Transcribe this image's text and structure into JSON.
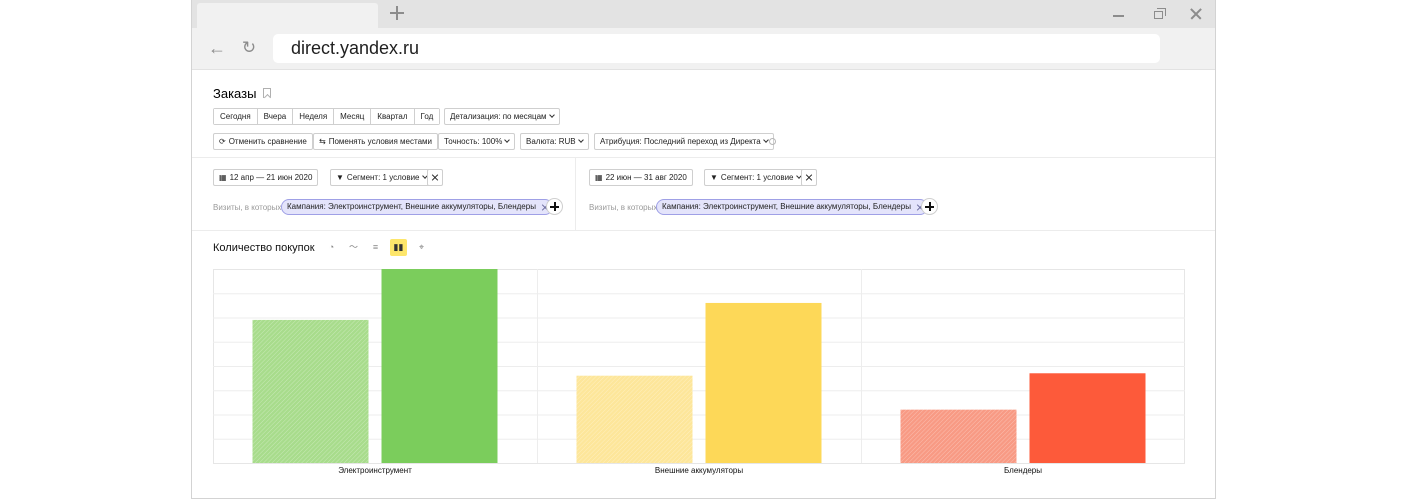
{
  "browser": {
    "url": "direct.yandex.ru"
  },
  "page": {
    "title": "Заказы",
    "periods": [
      "Сегодня",
      "Вчера",
      "Неделя",
      "Месяц",
      "Квартал",
      "Год"
    ],
    "detail_label": "Детализация: по месяцам",
    "toolbar": {
      "cancel_compare": "Отменить сравнение",
      "swap_conditions": "Поменять условия местами",
      "accuracy": "Точность: 100%",
      "currency": "Валюта: RUB",
      "attribution": "Атрибуция: Последний переход из Директа"
    },
    "left_panel": {
      "date_range": "12 апр — 21 июн 2020",
      "segment": "Сегмент: 1 условие",
      "visits_label": "Визиты, в которых",
      "chip": "Кампания: Электроинструмент, Внешние аккумуляторы, Блендеры"
    },
    "right_panel": {
      "date_range": "22 июн — 31 авг 2020",
      "segment": "Сегмент: 1 условие",
      "visits_label": "Визиты, в которых",
      "chip": "Кампания: Электроинструмент, Внешние аккумуляторы, Блендеры"
    },
    "chart_title": "Количество покупок",
    "chart_types": [
      "pie-chart-icon",
      "line-chart-icon",
      "stacked-bar-icon",
      "bar-chart-icon",
      "map-pin-icon"
    ]
  },
  "chart_data": {
    "type": "bar",
    "categories": [
      "Электроинструмент",
      "Внешние аккумуляторы",
      "Блендеры"
    ],
    "series": [
      {
        "values": [
          59,
          36,
          22
        ]
      },
      {
        "values": [
          80,
          66,
          37
        ]
      }
    ],
    "ylim": [
      0,
      80
    ],
    "grid": true,
    "colors": {
      "Электроинструмент": [
        "#a8dc8c",
        "#7bcd5c"
      ],
      "Внешние аккумуляторы": [
        "#fde69a",
        "#fdd858"
      ],
      "Блендеры": [
        "#f89a84",
        "#fd5a3a"
      ]
    }
  }
}
